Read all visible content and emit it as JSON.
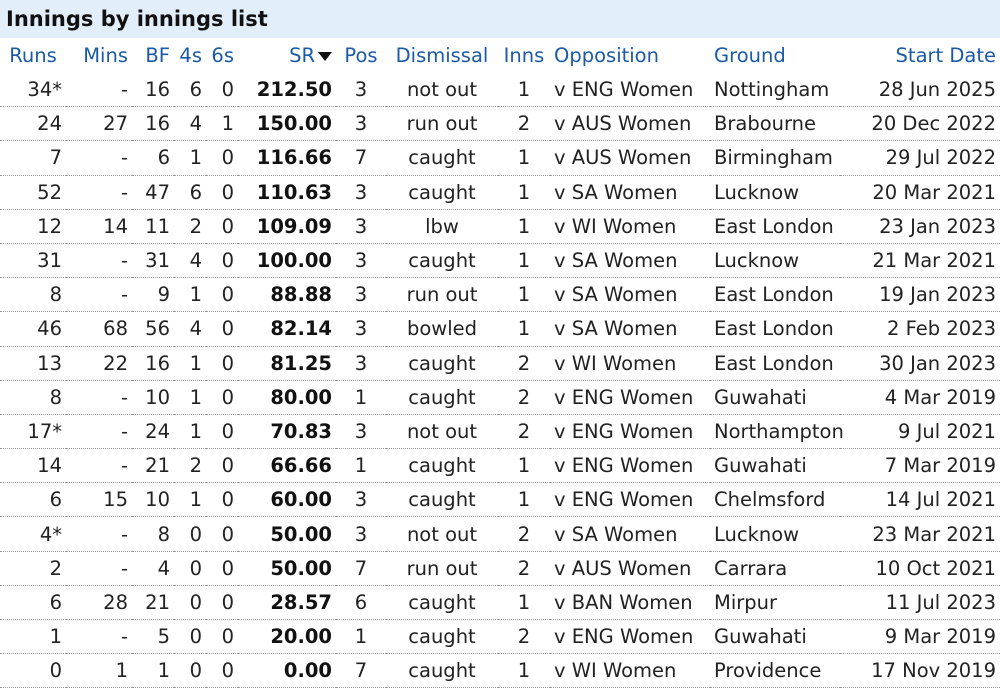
{
  "title": "Innings by innings list",
  "headers": {
    "runs": "Runs",
    "mins": "Mins",
    "bf": "BF",
    "fours": "4s",
    "sixes": "6s",
    "sr": "SR",
    "pos": "Pos",
    "dismissal": "Dismissal",
    "inns": "Inns",
    "opposition": "Opposition",
    "ground": "Ground",
    "start_date": "Start Date"
  },
  "sort_icon": "caret-down-icon",
  "rows": [
    {
      "runs": "34*",
      "mins": "-",
      "bf": "16",
      "fours": "6",
      "sixes": "0",
      "sr": "212.50",
      "pos": "3",
      "dismissal": "not out",
      "inns": "1",
      "opposition": "v ENG Women",
      "ground": "Nottingham",
      "start_date": "28 Jun 2025"
    },
    {
      "runs": "24",
      "mins": "27",
      "bf": "16",
      "fours": "4",
      "sixes": "1",
      "sr": "150.00",
      "pos": "3",
      "dismissal": "run out",
      "inns": "2",
      "opposition": "v AUS Women",
      "ground": "Brabourne",
      "start_date": "20 Dec 2022"
    },
    {
      "runs": "7",
      "mins": "-",
      "bf": "6",
      "fours": "1",
      "sixes": "0",
      "sr": "116.66",
      "pos": "7",
      "dismissal": "caught",
      "inns": "1",
      "opposition": "v AUS Women",
      "ground": "Birmingham",
      "start_date": "29 Jul 2022"
    },
    {
      "runs": "52",
      "mins": "-",
      "bf": "47",
      "fours": "6",
      "sixes": "0",
      "sr": "110.63",
      "pos": "3",
      "dismissal": "caught",
      "inns": "1",
      "opposition": "v SA Women",
      "ground": "Lucknow",
      "start_date": "20 Mar 2021"
    },
    {
      "runs": "12",
      "mins": "14",
      "bf": "11",
      "fours": "2",
      "sixes": "0",
      "sr": "109.09",
      "pos": "3",
      "dismissal": "lbw",
      "inns": "1",
      "opposition": "v WI Women",
      "ground": "East London",
      "start_date": "23 Jan 2023"
    },
    {
      "runs": "31",
      "mins": "-",
      "bf": "31",
      "fours": "4",
      "sixes": "0",
      "sr": "100.00",
      "pos": "3",
      "dismissal": "caught",
      "inns": "1",
      "opposition": "v SA Women",
      "ground": "Lucknow",
      "start_date": "21 Mar 2021"
    },
    {
      "runs": "8",
      "mins": "-",
      "bf": "9",
      "fours": "1",
      "sixes": "0",
      "sr": "88.88",
      "pos": "3",
      "dismissal": "run out",
      "inns": "1",
      "opposition": "v SA Women",
      "ground": "East London",
      "start_date": "19 Jan 2023"
    },
    {
      "runs": "46",
      "mins": "68",
      "bf": "56",
      "fours": "4",
      "sixes": "0",
      "sr": "82.14",
      "pos": "3",
      "dismissal": "bowled",
      "inns": "1",
      "opposition": "v SA Women",
      "ground": "East London",
      "start_date": "2 Feb 2023"
    },
    {
      "runs": "13",
      "mins": "22",
      "bf": "16",
      "fours": "1",
      "sixes": "0",
      "sr": "81.25",
      "pos": "3",
      "dismissal": "caught",
      "inns": "2",
      "opposition": "v WI Women",
      "ground": "East London",
      "start_date": "30 Jan 2023"
    },
    {
      "runs": "8",
      "mins": "-",
      "bf": "10",
      "fours": "1",
      "sixes": "0",
      "sr": "80.00",
      "pos": "1",
      "dismissal": "caught",
      "inns": "2",
      "opposition": "v ENG Women",
      "ground": "Guwahati",
      "start_date": "4 Mar 2019"
    },
    {
      "runs": "17*",
      "mins": "-",
      "bf": "24",
      "fours": "1",
      "sixes": "0",
      "sr": "70.83",
      "pos": "3",
      "dismissal": "not out",
      "inns": "2",
      "opposition": "v ENG Women",
      "ground": "Northampton",
      "start_date": "9 Jul 2021"
    },
    {
      "runs": "14",
      "mins": "-",
      "bf": "21",
      "fours": "2",
      "sixes": "0",
      "sr": "66.66",
      "pos": "1",
      "dismissal": "caught",
      "inns": "1",
      "opposition": "v ENG Women",
      "ground": "Guwahati",
      "start_date": "7 Mar 2019"
    },
    {
      "runs": "6",
      "mins": "15",
      "bf": "10",
      "fours": "1",
      "sixes": "0",
      "sr": "60.00",
      "pos": "3",
      "dismissal": "caught",
      "inns": "1",
      "opposition": "v ENG Women",
      "ground": "Chelmsford",
      "start_date": "14 Jul 2021"
    },
    {
      "runs": "4*",
      "mins": "-",
      "bf": "8",
      "fours": "0",
      "sixes": "0",
      "sr": "50.00",
      "pos": "3",
      "dismissal": "not out",
      "inns": "2",
      "opposition": "v SA Women",
      "ground": "Lucknow",
      "start_date": "23 Mar 2021"
    },
    {
      "runs": "2",
      "mins": "-",
      "bf": "4",
      "fours": "0",
      "sixes": "0",
      "sr": "50.00",
      "pos": "7",
      "dismissal": "run out",
      "inns": "2",
      "opposition": "v AUS Women",
      "ground": "Carrara",
      "start_date": "10 Oct 2021"
    },
    {
      "runs": "6",
      "mins": "28",
      "bf": "21",
      "fours": "0",
      "sixes": "0",
      "sr": "28.57",
      "pos": "6",
      "dismissal": "caught",
      "inns": "1",
      "opposition": "v BAN Women",
      "ground": "Mirpur",
      "start_date": "11 Jul 2023"
    },
    {
      "runs": "1",
      "mins": "-",
      "bf": "5",
      "fours": "0",
      "sixes": "0",
      "sr": "20.00",
      "pos": "1",
      "dismissal": "caught",
      "inns": "2",
      "opposition": "v ENG Women",
      "ground": "Guwahati",
      "start_date": "9 Mar 2019"
    },
    {
      "runs": "0",
      "mins": "1",
      "bf": "1",
      "fours": "0",
      "sixes": "0",
      "sr": "0.00",
      "pos": "7",
      "dismissal": "caught",
      "inns": "1",
      "opposition": "v WI Women",
      "ground": "Providence",
      "start_date": "17 Nov 2019"
    }
  ]
}
